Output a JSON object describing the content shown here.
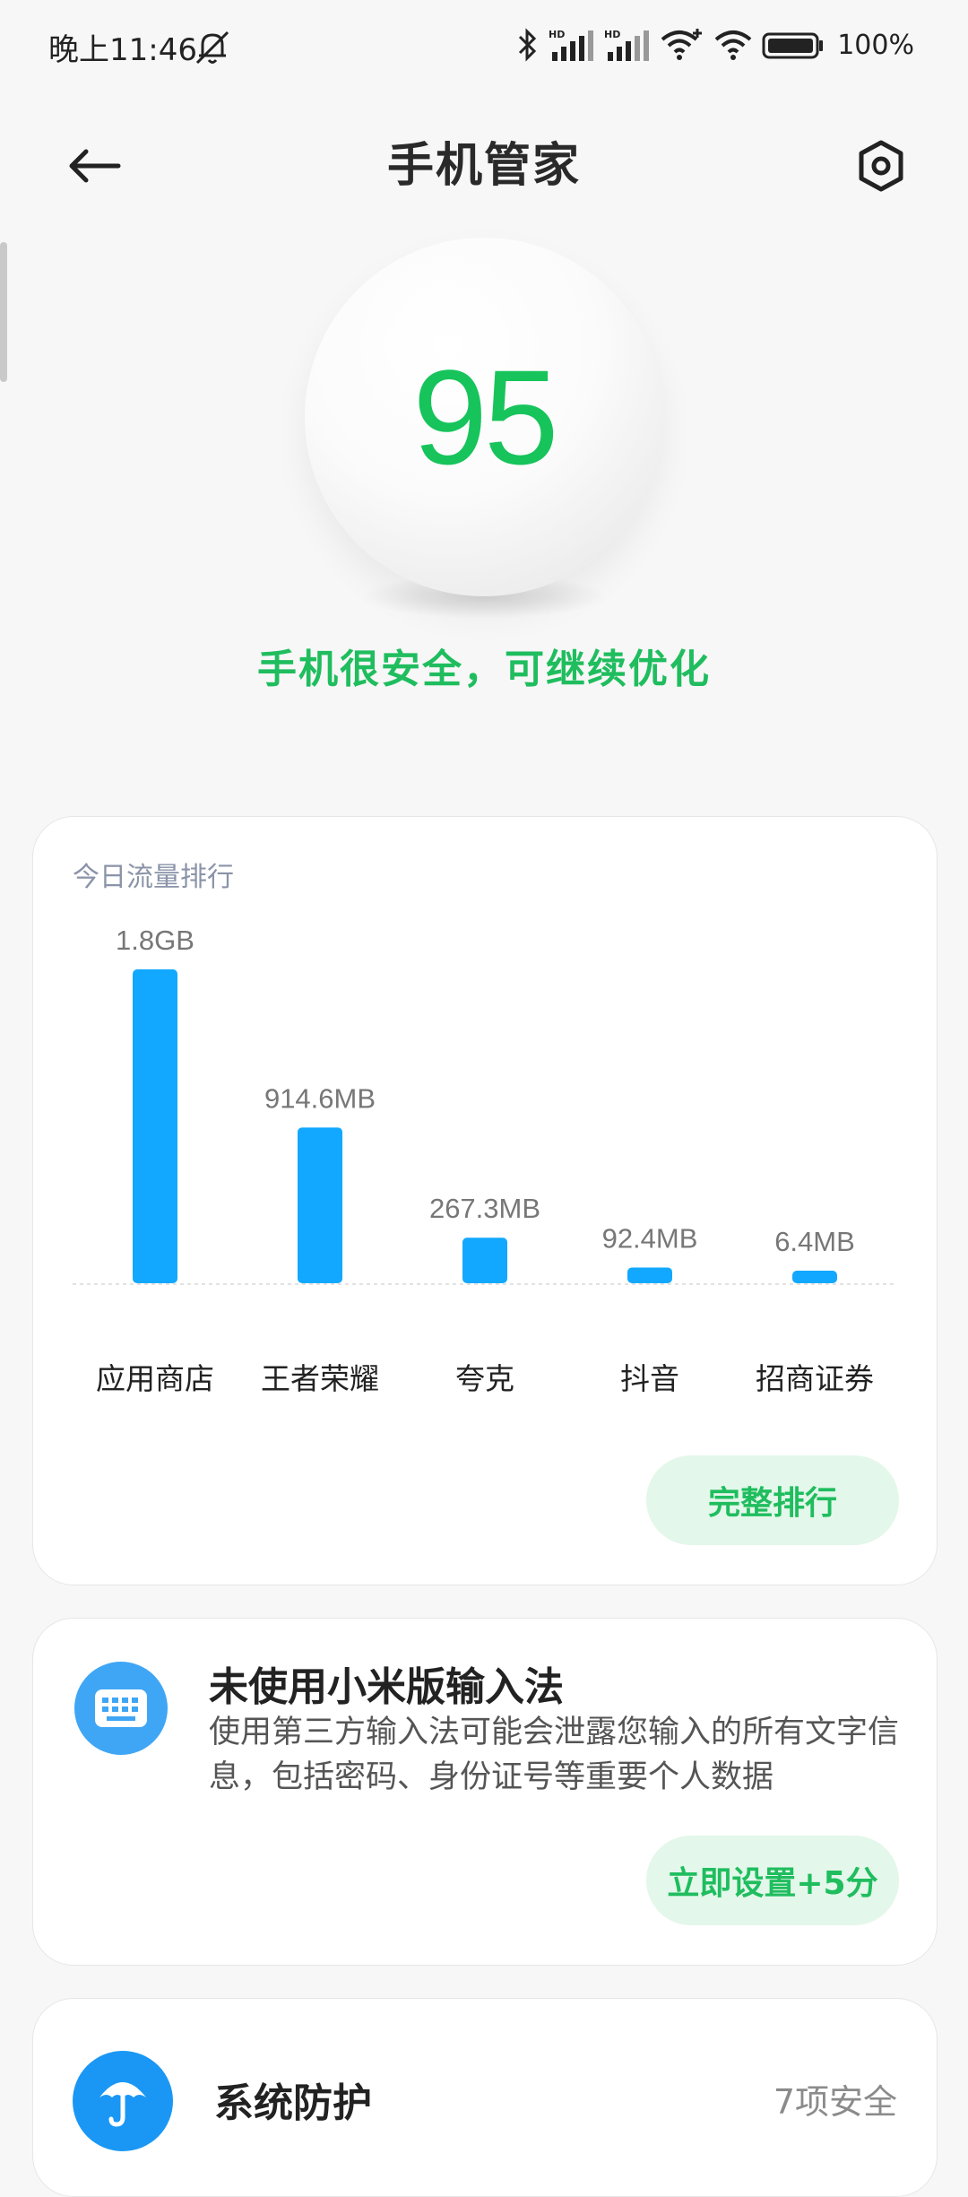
{
  "status_bar": {
    "time": "晚上11:46",
    "battery": "100%"
  },
  "header": {
    "title": "手机管家"
  },
  "score": {
    "value": "95",
    "message": "手机很安全，可继续优化"
  },
  "traffic": {
    "title": "今日流量排行",
    "button": "完整排行",
    "bar_color": "#12a8ff"
  },
  "chart_data": {
    "type": "bar",
    "title": "今日流量排行",
    "categories": [
      "应用商店",
      "王者荣耀",
      "夸克",
      "抖音",
      "招商证券"
    ],
    "values": [
      1843.2,
      914.6,
      267.3,
      92.4,
      6.4
    ],
    "unit": "MB",
    "value_labels": [
      "1.8GB",
      "914.6MB",
      "267.3MB",
      "92.4MB",
      "6.4MB"
    ]
  },
  "input_card": {
    "title": "未使用小米版输入法",
    "description": "使用第三方输入法可能会泄露您输入的所有文字信息，包括密码、身份证号等重要个人数据",
    "button": "立即设置+5分"
  },
  "protection_card": {
    "title": "系统防护",
    "status": "7项安全"
  }
}
